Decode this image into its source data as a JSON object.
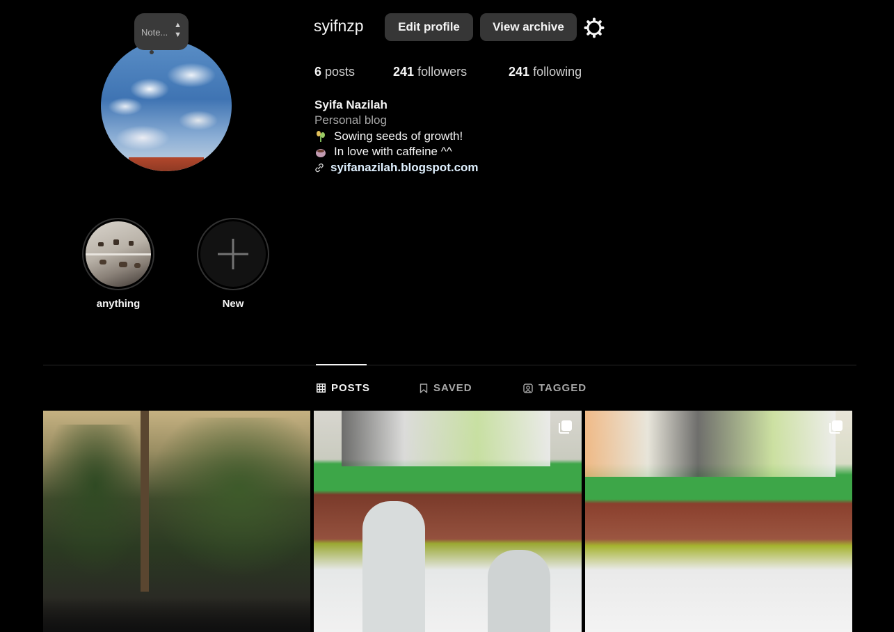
{
  "profile": {
    "username": "syifnzp",
    "note_text": "Note...",
    "buttons": {
      "edit": "Edit profile",
      "archive": "View archive"
    },
    "stats": {
      "posts_count": "6",
      "posts_label": "posts",
      "followers_count": "241",
      "followers_label": "followers",
      "following_count": "241",
      "following_label": "following"
    },
    "bio": {
      "name": "Syifa Nazilah",
      "category": "Personal blog",
      "line1": "Sowing seeds of growth!",
      "line2": "In love with caffeine ^^",
      "link": "syifanazilah.blogspot.com"
    }
  },
  "highlights": [
    {
      "label": "anything"
    },
    {
      "label": "New"
    }
  ],
  "tabs": [
    {
      "label": "POSTS",
      "active": true
    },
    {
      "label": "SAVED",
      "active": false
    },
    {
      "label": "TAGGED",
      "active": false
    }
  ],
  "colors": {
    "background": "#000000",
    "button": "#363636",
    "link": "#e0f1ff"
  },
  "icons": [
    "settings-gear-icon",
    "link-icon",
    "plus-icon",
    "grid-icon",
    "bookmark-icon",
    "tag-user-icon",
    "multiple-photos-icon"
  ]
}
